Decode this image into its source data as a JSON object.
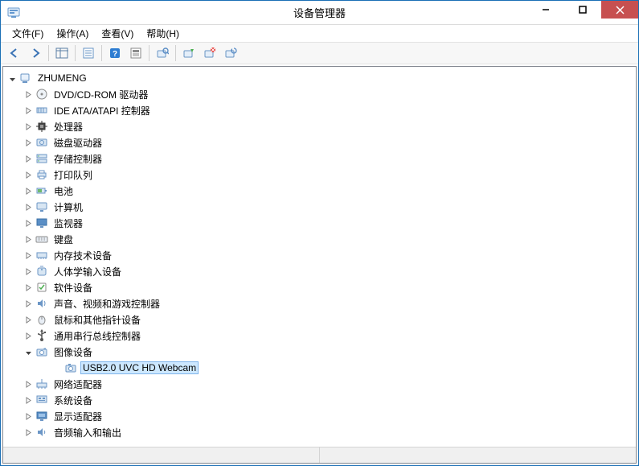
{
  "window": {
    "title": "设备管理器"
  },
  "menu": {
    "file": "文件(F)",
    "action": "操作(A)",
    "view": "查看(V)",
    "help": "帮助(H)"
  },
  "tree": {
    "root": "ZHUMENG",
    "items": [
      {
        "label": "DVD/CD-ROM 驱动器",
        "icon": "cd-icon"
      },
      {
        "label": "IDE ATA/ATAPI 控制器",
        "icon": "ide-icon"
      },
      {
        "label": "处理器",
        "icon": "cpu-icon"
      },
      {
        "label": "磁盘驱动器",
        "icon": "disk-icon"
      },
      {
        "label": "存储控制器",
        "icon": "storage-icon"
      },
      {
        "label": "打印队列",
        "icon": "printer-icon"
      },
      {
        "label": "电池",
        "icon": "battery-icon"
      },
      {
        "label": "计算机",
        "icon": "computer-icon"
      },
      {
        "label": "监视器",
        "icon": "monitor-icon"
      },
      {
        "label": "键盘",
        "icon": "keyboard-icon"
      },
      {
        "label": "内存技术设备",
        "icon": "memory-icon"
      },
      {
        "label": "人体学输入设备",
        "icon": "hid-icon"
      },
      {
        "label": "软件设备",
        "icon": "software-icon"
      },
      {
        "label": "声音、视频和游戏控制器",
        "icon": "sound-icon"
      },
      {
        "label": "鼠标和其他指针设备",
        "icon": "mouse-icon"
      },
      {
        "label": "通用串行总线控制器",
        "icon": "usb-icon"
      },
      {
        "label": "图像设备",
        "icon": "imaging-icon",
        "expanded": true,
        "children": [
          {
            "label": "USB2.0 UVC HD Webcam",
            "icon": "camera-icon",
            "selected": true
          }
        ]
      },
      {
        "label": "网络适配器",
        "icon": "network-icon"
      },
      {
        "label": "系统设备",
        "icon": "system-icon"
      },
      {
        "label": "显示适配器",
        "icon": "display-icon"
      },
      {
        "label": "音频输入和输出",
        "icon": "audio-icon"
      }
    ]
  }
}
